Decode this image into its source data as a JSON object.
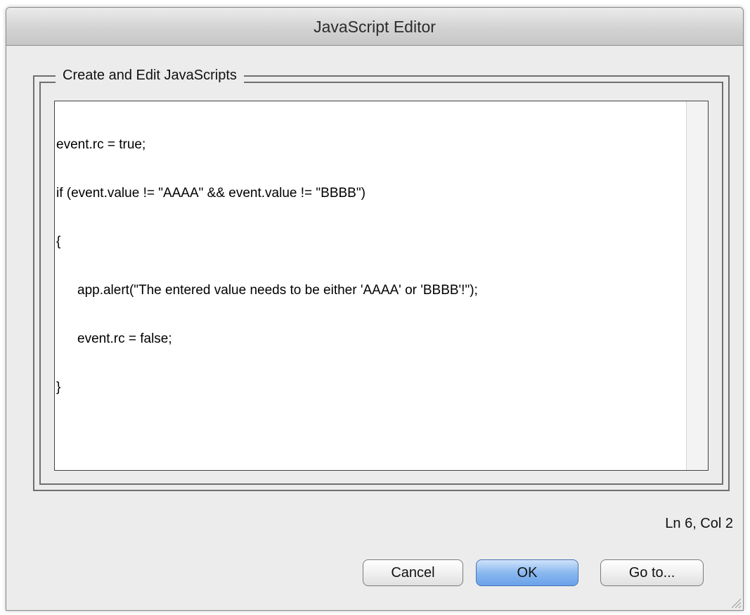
{
  "window": {
    "title": "JavaScript Editor"
  },
  "group": {
    "legend": "Create and Edit JavaScripts"
  },
  "editor": {
    "lines": [
      "event.rc = true;",
      "if (event.value != \"AAAA\" && event.value != \"BBBB\")",
      "{",
      "app.alert(\"The entered value needs to be either 'AAAA' or 'BBBB'!\");",
      "event.rc = false;",
      "}"
    ]
  },
  "status": {
    "cursor_position": "Ln 6, Col 2"
  },
  "buttons": {
    "cancel": "Cancel",
    "ok": "OK",
    "goto": "Go to..."
  },
  "colors": {
    "window_background": "#ececec",
    "default_button": "#8ab8ef"
  }
}
